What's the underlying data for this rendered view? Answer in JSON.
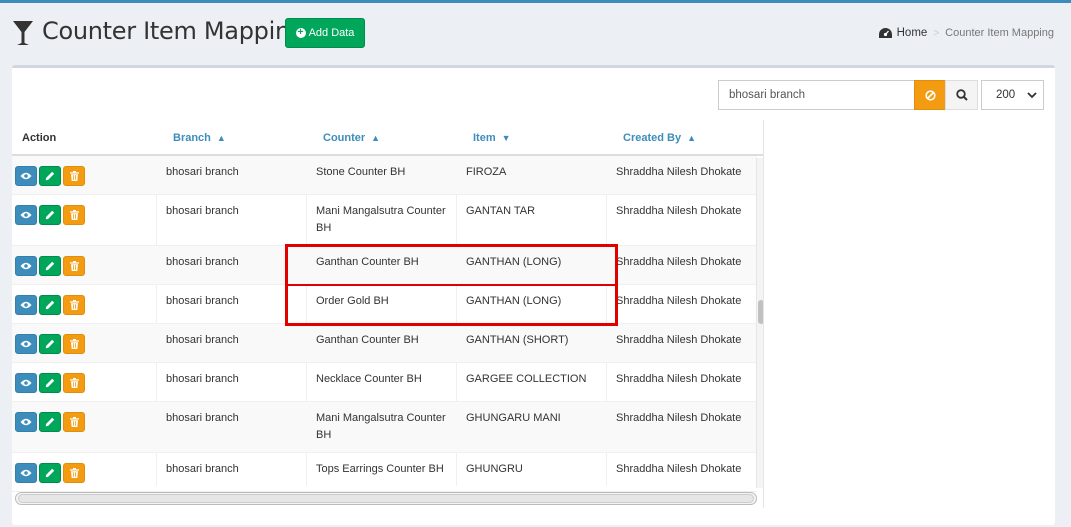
{
  "page": {
    "title": "Counter Item Mapping",
    "add_button_label": "Add Data"
  },
  "breadcrumb": {
    "home": "Home",
    "current": "Counter Item Mapping"
  },
  "toolbar": {
    "search_value": "bhosari branch",
    "page_size": "200"
  },
  "table": {
    "headers": {
      "action": "Action",
      "branch": "Branch",
      "counter": "Counter",
      "item": "Item",
      "created_by": "Created By"
    },
    "rows": [
      {
        "branch": "bhosari branch",
        "counter": "Stone Counter BH",
        "item": "FIROZA",
        "created_by": "Shraddha Nilesh Dhokate"
      },
      {
        "branch": "bhosari branch",
        "counter": "Mani Mangalsutra Counter BH",
        "item": "GANTAN TAR",
        "created_by": "Shraddha Nilesh Dhokate"
      },
      {
        "branch": "bhosari branch",
        "counter": "Ganthan Counter BH",
        "item": "GANTHAN (LONG)",
        "created_by": "Shraddha Nilesh Dhokate"
      },
      {
        "branch": "bhosari branch",
        "counter": "Order Gold BH",
        "item": "GANTHAN (LONG)",
        "created_by": "Shraddha Nilesh Dhokate"
      },
      {
        "branch": "bhosari branch",
        "counter": "Ganthan Counter BH",
        "item": "GANTHAN (SHORT)",
        "created_by": "Shraddha Nilesh Dhokate"
      },
      {
        "branch": "bhosari branch",
        "counter": "Necklace Counter BH",
        "item": "GARGEE COLLECTION",
        "created_by": "Shraddha Nilesh Dhokate"
      },
      {
        "branch": "bhosari branch",
        "counter": "Mani Mangalsutra Counter BH",
        "item": "GHUNGARU MANI",
        "created_by": "Shraddha Nilesh Dhokate"
      },
      {
        "branch": "bhosari branch",
        "counter": "Tops Earrings Counter BH",
        "item": "GHUNGRU",
        "created_by": "Shraddha Nilesh Dhokate"
      }
    ]
  },
  "colors": {
    "view": "#3c8dbc",
    "edit": "#00a65a",
    "delete": "#f39c12",
    "highlight": "#e00000"
  },
  "icons": [
    "filter-icon",
    "plus-circle-icon",
    "dashboard-icon",
    "ban-icon",
    "search-icon",
    "chevron-down-icon",
    "eye-icon",
    "pencil-icon",
    "trash-icon",
    "sort-icon",
    "sort-down-icon"
  ]
}
